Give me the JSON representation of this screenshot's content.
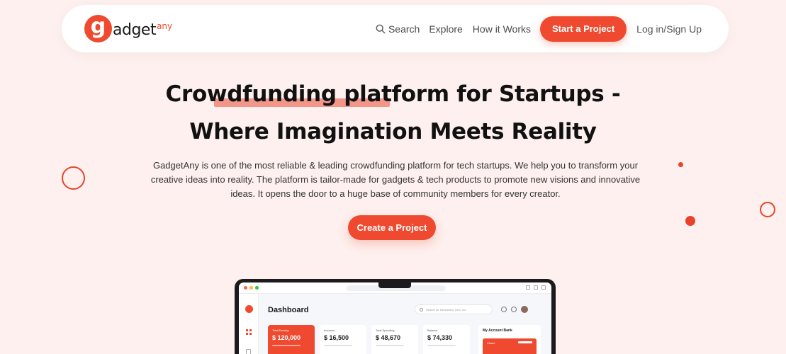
{
  "navbar": {
    "logo_letter": "g",
    "logo_text": "adget",
    "logo_sup": "any",
    "search_label": "Search",
    "explore_label": "Explore",
    "how_label": "How it Works",
    "start_label": "Start a Project",
    "login_label": "Log in/Sign Up"
  },
  "hero": {
    "title_line1": "Crowdfunding platform for Startups -",
    "title_line2": "Where Imagination Meets Reality",
    "description": "GadgetAny is one of the most reliable & leading crowdfunding platform for tech startups. We help you to transform your creative ideas into reality. The platform is tailor-made for gadgets & tech products to promote new visions and innovative ideas. It opens the door to a huge base of community members for every creator.",
    "cta_label": "Create a Project"
  },
  "dashboard": {
    "title": "Dashboard",
    "search_placeholder": "Search for transaction, item, etc",
    "cards": [
      {
        "label": "Total Earning",
        "value": "$ 120,000"
      },
      {
        "label": "Incomes",
        "value": "$ 16,500"
      },
      {
        "label": "Total Spending",
        "value": "$ 48,670"
      },
      {
        "label": "Balance",
        "value": "$ 74,330"
      }
    ],
    "bank_title": "My Account Bank",
    "bank_card_label": "Chase"
  },
  "colors": {
    "accent": "#ef4a2f",
    "background": "#fdf0ee",
    "highlight": "#f3968a"
  }
}
